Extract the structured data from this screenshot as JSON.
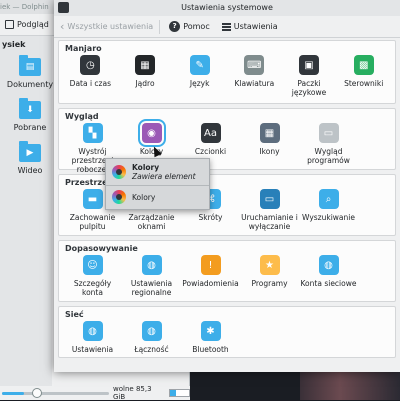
{
  "dolphin": {
    "title": "iek — Dolphin",
    "toolbar": {
      "preview_label": "Podgląd"
    },
    "places_header": "ysiek",
    "files": [
      {
        "label": "Dokumenty",
        "icon": "folder-documents-icon",
        "glyph": "▤"
      },
      {
        "label": "Pobrane",
        "icon": "folder-download-icon",
        "glyph": "⬇"
      },
      {
        "label": "Wideo",
        "icon": "folder-video-icon",
        "glyph": "▶"
      }
    ],
    "status": {
      "free_space": "wolne 85,3 GiB"
    }
  },
  "settings": {
    "title": "Ustawienia systemowe",
    "toolbar": {
      "back_label": "Wszystkie ustawienia",
      "help_label": "Pomoc",
      "settings_label": "Ustawienia"
    },
    "sections": [
      {
        "title": "Manjaro",
        "items": [
          {
            "label": "Data i czas",
            "icon": "clock-icon",
            "color": "#31363b",
            "glyph": "◷"
          },
          {
            "label": "Jądro",
            "icon": "kernel-icon",
            "color": "#232629",
            "glyph": "▦"
          },
          {
            "label": "Język",
            "icon": "language-icon",
            "color": "#3daee9",
            "glyph": "✎"
          },
          {
            "label": "Klawiatura",
            "icon": "keyboard-icon",
            "color": "#7f8c8d",
            "glyph": "⌨"
          },
          {
            "label": "Paczki\njęzykowe",
            "icon": "language-packages-icon",
            "color": "#31363b",
            "glyph": "▣"
          },
          {
            "label": "Sterowniki",
            "icon": "drivers-icon",
            "color": "#27ae60",
            "glyph": "▩"
          }
        ]
      },
      {
        "title": "Wygląd",
        "items": [
          {
            "label": "Wystrój\nprzestrzeni\nroboczej",
            "icon": "workspace-theme-icon",
            "color": "#3daee9",
            "glyph": "▚"
          },
          {
            "label": "Kolory",
            "icon": "colors-icon",
            "color": "#9b59b6",
            "glyph": "◉",
            "selected": true
          },
          {
            "label": "Czcionki",
            "icon": "fonts-icon",
            "color": "#31363b",
            "glyph": "Aa"
          },
          {
            "label": "Ikony",
            "icon": "icons-icon",
            "color": "#5d6d7e",
            "glyph": "▦"
          },
          {
            "label": "Wygląd\nprogramów",
            "icon": "application-style-icon",
            "color": "#bdc3c7",
            "glyph": "▭"
          }
        ]
      },
      {
        "title": "Przestrzeń r",
        "items": [
          {
            "label": "Zachowanie\npulpitu",
            "icon": "desktop-behavior-icon",
            "color": "#3daee9",
            "glyph": "▬"
          },
          {
            "label": "Zarządzanie\noknami",
            "icon": "window-management-icon",
            "color": "#31363b",
            "glyph": "▢"
          },
          {
            "label": "Skróty",
            "icon": "shortcuts-icon",
            "color": "#3daee9",
            "glyph": "⌘"
          },
          {
            "label": "Uruchamianie i\nwyłączanie",
            "icon": "startup-shutdown-icon",
            "color": "#2980b9",
            "glyph": "▭"
          },
          {
            "label": "Wyszukiwanie",
            "icon": "search-icon",
            "color": "#3daee9",
            "glyph": "⌕"
          }
        ]
      },
      {
        "title": "Dopasowywanie",
        "items": [
          {
            "label": "Szczegóły\nkonta",
            "icon": "account-icon",
            "color": "#3daee9",
            "glyph": "☺"
          },
          {
            "label": "Ustawienia\nregionalne",
            "icon": "regional-settings-icon",
            "color": "#3daee9",
            "glyph": "◍"
          },
          {
            "label": "Powiadomienia",
            "icon": "notifications-icon",
            "color": "#f39c1f",
            "glyph": "!"
          },
          {
            "label": "Programy",
            "icon": "applications-icon",
            "color": "#fdbc4b",
            "glyph": "★"
          },
          {
            "label": "Konta sieciowe",
            "icon": "online-accounts-icon",
            "color": "#3daee9",
            "glyph": "◍"
          }
        ]
      },
      {
        "title": "Sieć",
        "items": [
          {
            "label": "Ustawienia",
            "icon": "network-settings-icon",
            "color": "#3daee9",
            "glyph": "◍"
          },
          {
            "label": "Łączność",
            "icon": "connections-icon",
            "color": "#3daee9",
            "glyph": "◍"
          },
          {
            "label": "Bluetooth",
            "icon": "bluetooth-icon",
            "color": "#3daee9",
            "glyph": "✱"
          }
        ]
      }
    ],
    "popup": {
      "title": "Kolory",
      "subtitle": "Zawiera element",
      "entry": "Kolory"
    }
  }
}
